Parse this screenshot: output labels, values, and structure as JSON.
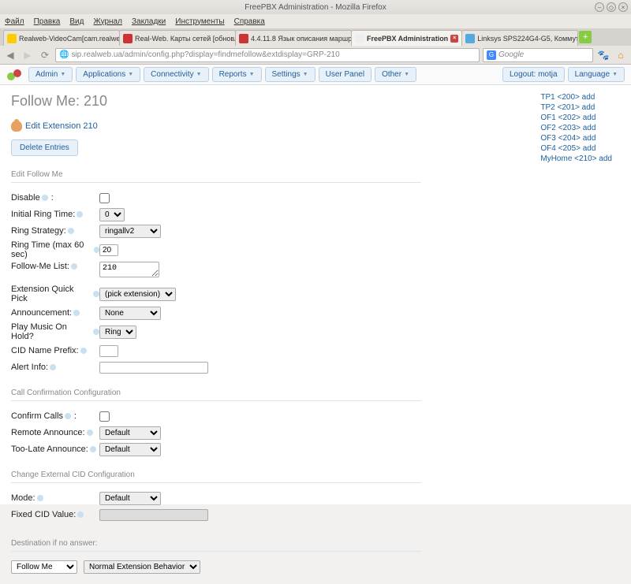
{
  "window": {
    "title": "FreePBX Administration - Mozilla Firefox"
  },
  "menubar": [
    "Файл",
    "Правка",
    "Вид",
    "Журнал",
    "Закладки",
    "Инструменты",
    "Справка"
  ],
  "tabs": [
    {
      "label": "Realweb-VideoCam[cam.realweb..."
    },
    {
      "label": "Real-Web. Карты сетей [обновл..."
    },
    {
      "label": "4.4.11.8 Язык описания маршр..."
    },
    {
      "label": "FreePBX Administration",
      "active": true
    },
    {
      "label": "Linksys SPS224G4-G5, Коммутат..."
    }
  ],
  "url": "sip.realweb.ua/admin/config.php?display=findmefollow&extdisplay=GRP-210",
  "search_placeholder": "Google",
  "nav": {
    "items": [
      "Admin",
      "Applications",
      "Connectivity",
      "Reports",
      "Settings",
      "User Panel",
      "Other"
    ],
    "logout": "Logout: motja",
    "language": "Language"
  },
  "page": {
    "title": "Follow Me: 210",
    "edit_link": "Edit Extension 210",
    "delete_btn": "Delete Entries"
  },
  "sections": {
    "edit": "Edit Follow Me",
    "confirm": "Call Confirmation Configuration",
    "cid": "Change External CID Configuration",
    "dest": "Destination if no answer:"
  },
  "fields": {
    "disable": "Disable",
    "initial_ring": "Initial Ring Time:",
    "initial_ring_val": "0",
    "ring_strategy": "Ring Strategy:",
    "ring_strategy_val": "ringallv2",
    "ring_time": "Ring Time (max 60 sec)",
    "ring_time_val": "20",
    "followme_list": "Follow-Me List:",
    "followme_list_val": "210",
    "ext_quick": "Extension Quick Pick",
    "ext_quick_val": "(pick extension)",
    "announcement": "Announcement:",
    "announcement_val": "None",
    "music_hold": "Play Music On Hold?",
    "music_hold_val": "Ring",
    "cid_prefix": "CID Name Prefix:",
    "alert_info": "Alert Info:",
    "confirm_calls": "Confirm Calls",
    "remote_ann": "Remote Announce:",
    "remote_ann_val": "Default",
    "toolate_ann": "Too-Late Announce:",
    "toolate_ann_val": "Default",
    "mode": "Mode:",
    "mode_val": "Default",
    "fixed_cid": "Fixed CID Value:",
    "dest_sel": "Follow Me",
    "dest_sel2": "Normal Extension Behavior"
  },
  "sidebar": [
    "TP1 <200> add",
    "TP2 <201> add",
    "OF1 <202> add",
    "OF2 <203> add",
    "OF3 <204> add",
    "OF4 <205> add",
    "MyHome <210> add"
  ]
}
